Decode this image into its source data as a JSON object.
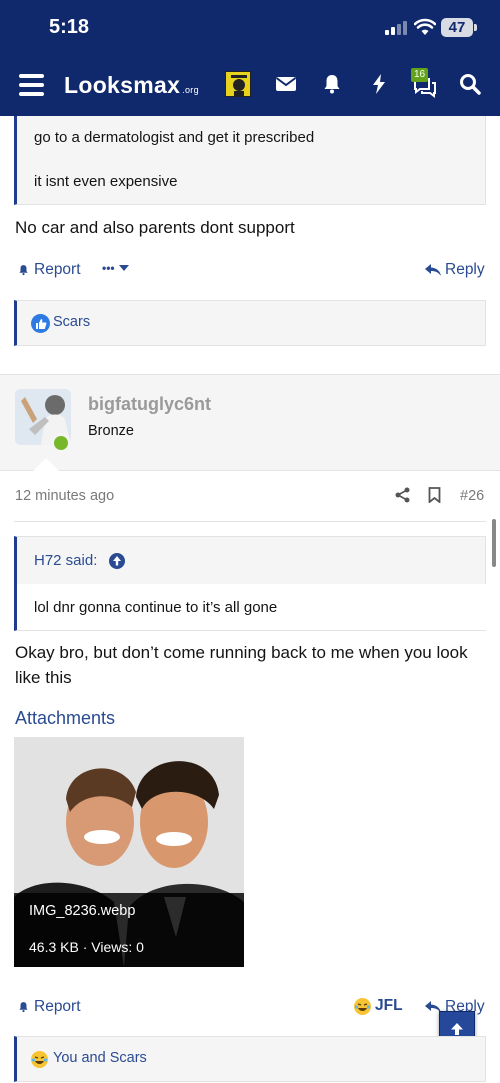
{
  "status": {
    "time": "5:18",
    "battery": "47"
  },
  "header": {
    "logo": "Looksmax",
    "logo_tld": ".org",
    "conversations_badge": "16"
  },
  "previous_post": {
    "quote_lines": [
      "go to a dermatologist and get it prescribed",
      "it isnt even expensive"
    ],
    "body": "No car and also parents dont support",
    "report_label": "Report",
    "more_label": "•••",
    "reply_label": "Reply",
    "reactions_text": "Scars"
  },
  "post": {
    "username": "bigfatuglyc6nt",
    "user_title": "Bronze",
    "time": "12 minutes ago",
    "number": "#26",
    "quote_author": "H72 said:",
    "quote_text": "lol dnr gonna continue to it’s all gone",
    "body": "Okay bro, but don’t come running back to me when you look like this",
    "attachments_title": "Attachments",
    "attachment": {
      "filename": "IMG_8236.webp",
      "meta": "46.3 KB · Views: 0"
    },
    "report_label": "Report",
    "jfl_label": "JFL",
    "reply_label": "Reply",
    "reactions_text": "You and Scars"
  },
  "colors": {
    "header": "#10296c",
    "link": "#2a4b92",
    "online": "#77b82a",
    "quote_bar": "#203c8c"
  }
}
